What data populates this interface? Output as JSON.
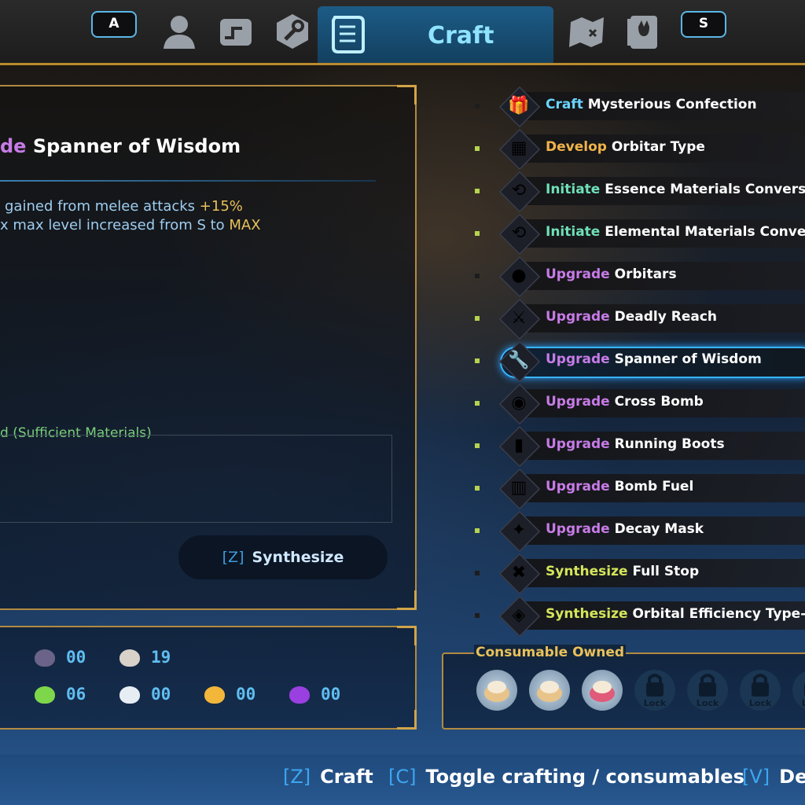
{
  "tabs": {
    "left_key": "A",
    "right_key": "S",
    "active_label": "Craft",
    "icons": [
      "character-icon",
      "map-scroll-icon",
      "wrench-icon",
      "craft-scroll-icon",
      "treasure-map-icon",
      "journal-icon"
    ]
  },
  "detail": {
    "title_verb": "de",
    "title_name": "Spanner of Wisdom",
    "effects": [
      {
        "text": "gained from melee attacks ",
        "highlight": "+15%"
      },
      {
        "text": "x max level increased from S to ",
        "highlight": "MAX"
      }
    ],
    "materials_status_prefix": "d",
    "materials_status": "(Sufficient Materials)",
    "synthesize_key": "[Z]",
    "synthesize_label": "Synthesize"
  },
  "inventory": [
    {
      "color": "#6b6488",
      "count": "00"
    },
    {
      "color": "#d8d2c8",
      "count": "19"
    },
    {
      "color": "#7ed64a",
      "count": "06"
    },
    {
      "color": "#e6eef4",
      "count": "00"
    },
    {
      "color": "#f2b73a",
      "count": "00"
    },
    {
      "color": "#9a3fe0",
      "count": "00"
    }
  ],
  "recipes": [
    {
      "verb": "Craft",
      "verb_class": "v-craft",
      "name": "Mysterious Confection",
      "bullet": "dim",
      "glyph": "🎁"
    },
    {
      "verb": "Develop",
      "verb_class": "v-develop",
      "name": "Orbitar Type",
      "bullet": "on",
      "glyph": "▦"
    },
    {
      "verb": "Initiate",
      "verb_class": "v-initiate",
      "name": "Essence Materials Conversion",
      "bullet": "on",
      "glyph": "⟲"
    },
    {
      "verb": "Initiate",
      "verb_class": "v-initiate",
      "name": "Elemental Materials Conversion",
      "bullet": "on",
      "glyph": "⟲"
    },
    {
      "verb": "Upgrade",
      "verb_class": "v-upgrade",
      "name": "Orbitars",
      "bullet": "dim",
      "glyph": "●"
    },
    {
      "verb": "Upgrade",
      "verb_class": "v-upgrade",
      "name": "Deadly Reach",
      "bullet": "on",
      "glyph": "⚔"
    },
    {
      "verb": "Upgrade",
      "verb_class": "v-upgrade",
      "name": "Spanner of Wisdom",
      "bullet": "on",
      "glyph": "🔧",
      "selected": true
    },
    {
      "verb": "Upgrade",
      "verb_class": "v-upgrade",
      "name": "Cross Bomb",
      "bullet": "on",
      "glyph": "◉"
    },
    {
      "verb": "Upgrade",
      "verb_class": "v-upgrade",
      "name": "Running Boots",
      "bullet": "on",
      "glyph": "▮"
    },
    {
      "verb": "Upgrade",
      "verb_class": "v-upgrade",
      "name": "Bomb Fuel",
      "bullet": "on",
      "glyph": "▥"
    },
    {
      "verb": "Upgrade",
      "verb_class": "v-upgrade",
      "name": "Decay Mask",
      "bullet": "on",
      "glyph": "✦"
    },
    {
      "verb": "Synthesize",
      "verb_class": "v-synth",
      "name": "Full Stop",
      "bullet": "dim",
      "glyph": "✖"
    },
    {
      "verb": "Synthesize",
      "verb_class": "v-synth",
      "name": "Orbital Efficiency Type-B",
      "bullet": "dim",
      "glyph": "◈"
    }
  ],
  "consumables": {
    "label": "Consumable Owned",
    "lock_text": "Lock",
    "slots": [
      "cream-puff",
      "cream-puff",
      "rainbow-cake",
      "lock",
      "lock",
      "lock",
      "lock"
    ]
  },
  "hints": [
    {
      "key": "[Z]",
      "label": "Craft"
    },
    {
      "key": "[C]",
      "label": "Toggle crafting / consumables"
    },
    {
      "key": "[V]",
      "label": "De"
    }
  ]
}
